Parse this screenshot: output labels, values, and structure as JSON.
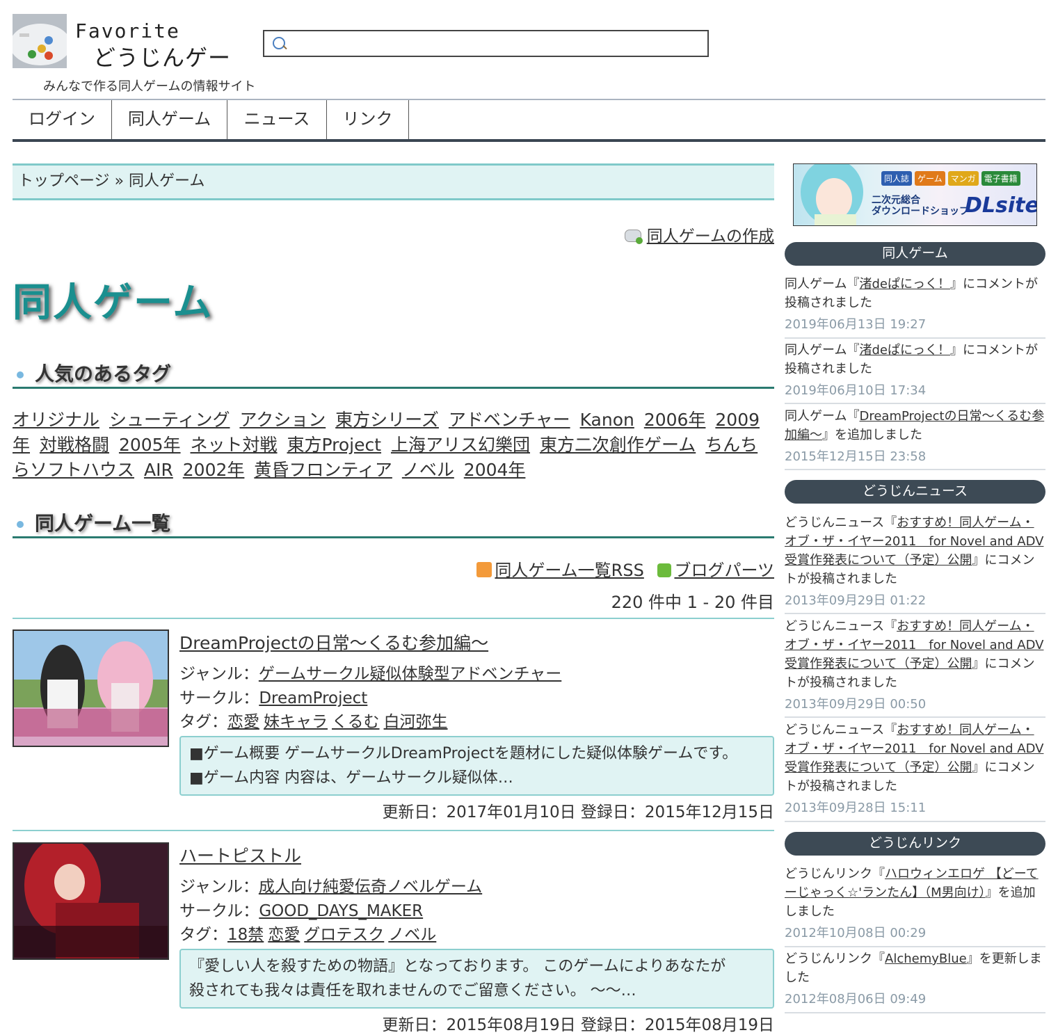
{
  "header": {
    "logo_line1": "Favorite",
    "logo_line2": "どうじんゲー",
    "tagline": "みんなで作る同人ゲームの情報サイト",
    "search_placeholder": ""
  },
  "nav": {
    "items": [
      {
        "label": "ログイン"
      },
      {
        "label": "同人ゲーム"
      },
      {
        "label": "ニュース"
      },
      {
        "label": "リンク"
      }
    ]
  },
  "breadcrumb": {
    "home": "トップページ",
    "sep": "»",
    "current": "同人ゲーム"
  },
  "create_link": "同人ゲームの作成",
  "page_title": "同人ゲーム",
  "popular_tags": {
    "heading": "人気のあるタグ",
    "tags": [
      "オリジナル",
      "シューティング",
      "アクション",
      "東方シリーズ",
      "アドベンチャー",
      "Kanon",
      "2006年",
      "2009年",
      "対戦格闘",
      "2005年",
      "ネット対戦",
      "東方Project",
      "上海アリス幻樂団",
      "東方二次創作ゲーム",
      "ちんちらソフトハウス",
      "AIR",
      "2002年",
      "黄昏フロンティア",
      "ノベル",
      "2004年"
    ]
  },
  "list": {
    "heading": "同人ゲーム一覧",
    "rss_label": "同人ゲーム一覧RSS",
    "parts_label": "ブログパーツ",
    "count_text": "220 件中 1 - 20 件目",
    "genre_prefix": "ジャンル：",
    "circle_prefix": "サークル：",
    "tags_prefix": "タグ：",
    "games": [
      {
        "title": "DreamProjectの日常～くるむ参加編～",
        "genre": "ゲームサークル疑似体験型アドベンチャー",
        "circle": "DreamProject",
        "tags": [
          "恋愛",
          "妹キャラ",
          "くるむ",
          "白河弥生"
        ],
        "desc_line1": "■ゲーム概要 ゲームサークルDreamProjectを題材にした疑似体験ゲームです。",
        "desc_line2": "■ゲーム内容 内容は、ゲームサークル疑似体…",
        "dates": "更新日：2017年01月10日 登録日：2015年12月15日"
      },
      {
        "title": "ハートピストル",
        "genre": "成人向け純愛伝奇ノベルゲーム",
        "circle": "GOOD_DAYS_MAKER",
        "tags": [
          "18禁",
          "恋愛",
          "グロテスク",
          "ノベル"
        ],
        "desc_line1": "『愛しい人を殺すための物語』となっております。 このゲームによりあなたが",
        "desc_line2": "殺されても我々は責任を取れませんのでご留意ください。 ～～…",
        "dates": "更新日：2015年08月19日 登録日：2015年08月19日"
      }
    ]
  },
  "sidebar": {
    "sections": [
      {
        "heading": "同人ゲーム",
        "items": [
          {
            "pre": "同人ゲーム『",
            "link": "渚deぱにっく！",
            "post": "』にコメントが投稿されました",
            "date": "2019年06月13日 19:27"
          },
          {
            "pre": "同人ゲーム『",
            "link": "渚deぱにっく！",
            "post": "』にコメントが投稿されました",
            "date": "2019年06月10日 17:34"
          },
          {
            "pre": "同人ゲーム『",
            "link": "DreamProjectの日常～くるむ参加編～",
            "post": "』を追加しました",
            "date": "2015年12月15日 23:58"
          }
        ]
      },
      {
        "heading": "どうじんニュース",
        "items": [
          {
            "pre": "どうじんニュース『",
            "link": "おすすめ！同人ゲーム・オブ・ザ・イヤー2011　for Novel and ADV受賞作発表について（予定）公開",
            "post": "』にコメントが投稿されました",
            "date": "2013年09月29日 01:22"
          },
          {
            "pre": "どうじんニュース『",
            "link": "おすすめ！同人ゲーム・オブ・ザ・イヤー2011　for Novel and ADV受賞作発表について（予定）公開",
            "post": "』にコメントが投稿されました",
            "date": "2013年09月29日 00:50"
          },
          {
            "pre": "どうじんニュース『",
            "link": "おすすめ！同人ゲーム・オブ・ザ・イヤー2011　for Novel and ADV受賞作発表について（予定）公開",
            "post": "』にコメントが投稿されました",
            "date": "2013年09月28日 15:11"
          }
        ]
      },
      {
        "heading": "どうじんリンク",
        "items": [
          {
            "pre": "どうじんリンク『",
            "link": "ハロウィンエロゲ 【どーてーじゃっく☆'ランたん】（M男向け）",
            "post": "』を追加しました",
            "date": "2012年10月08日 00:29"
          },
          {
            "pre": "どうじんリンク『",
            "link": "AlchemyBlue",
            "post": "』を更新しました",
            "date": "2012年08月06日 09:49"
          }
        ]
      }
    ],
    "banner": {
      "chips": [
        "同人誌",
        "ゲーム",
        "マンガ",
        "電子書籍"
      ],
      "line1": "二次元総合",
      "line2": "ダウンロードショップ",
      "brand": "DLsite"
    }
  }
}
